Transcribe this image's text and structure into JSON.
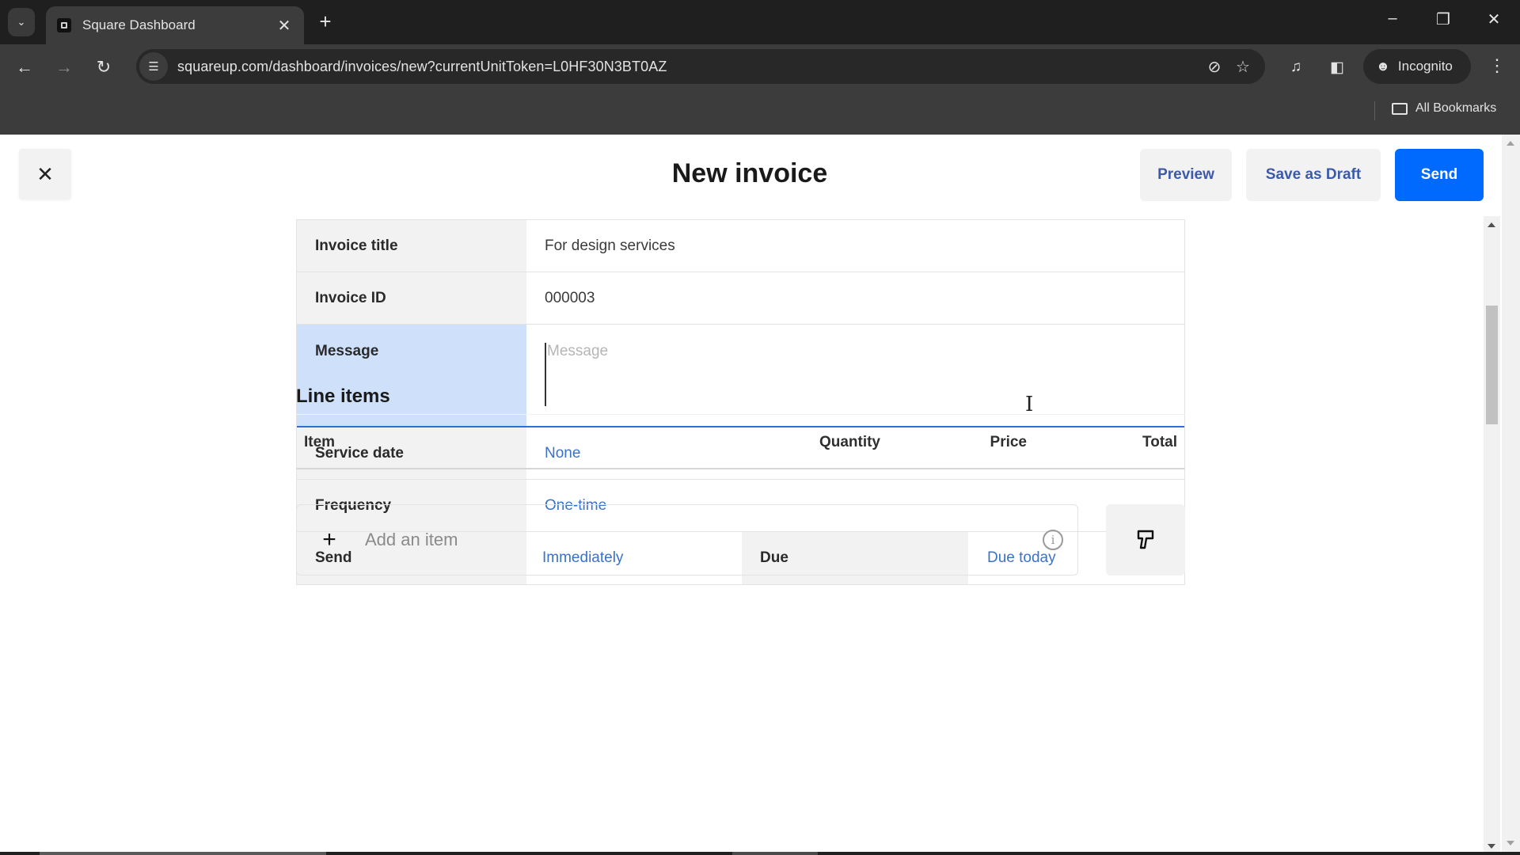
{
  "browser": {
    "tab_title": "Square Dashboard",
    "url": "squareup.com/dashboard/invoices/new?currentUnitToken=L0HF30N3BT0AZ",
    "profile_label": "Incognito",
    "bookmarks_label": "All Bookmarks",
    "icons": {
      "tab_search": "chevron-down-icon",
      "new_tab": "plus-icon",
      "back": "arrow-left-icon",
      "forward": "arrow-right-icon",
      "reload": "reload-icon",
      "site_info": "tune-icon",
      "tracking": "eye-off-icon",
      "bookmark": "star-icon",
      "media": "media-queue-icon",
      "side_panel": "side-panel-icon",
      "incognito": "incognito-icon",
      "menu": "kebab-menu-icon"
    }
  },
  "header": {
    "title": "New invoice",
    "close_label": "✕",
    "preview_label": "Preview",
    "save_draft_label": "Save as Draft",
    "send_label": "Send"
  },
  "form": {
    "invoice_title": {
      "label": "Invoice title",
      "value": "For design services"
    },
    "invoice_id": {
      "label": "Invoice ID",
      "value": "000003"
    },
    "message": {
      "label": "Message",
      "value": "",
      "placeholder": "Message"
    },
    "service_date": {
      "label": "Service date",
      "value": "None"
    },
    "frequency": {
      "label": "Frequency",
      "value": "One-time"
    },
    "send": {
      "label": "Send",
      "value": "Immediately"
    },
    "due": {
      "label": "Due",
      "value": "Due today"
    }
  },
  "line_items": {
    "heading": "Line items",
    "columns": [
      "Item",
      "Quantity",
      "Price",
      "Total"
    ],
    "rows": [],
    "add_placeholder": "Add an item",
    "info_glyph": "i"
  },
  "colors": {
    "primary": "#006aff",
    "link": "#3a72c8",
    "focus": "#2f6fd6"
  }
}
